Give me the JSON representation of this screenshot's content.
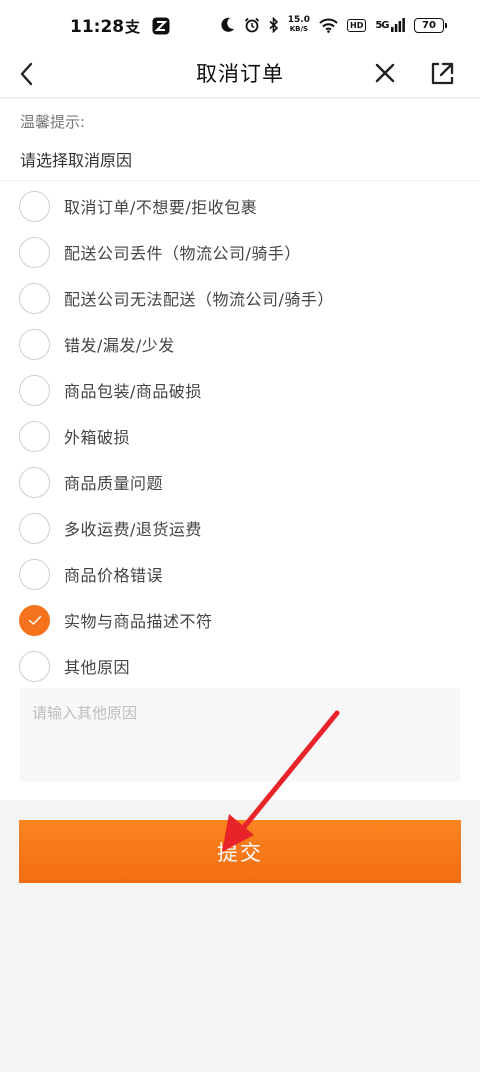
{
  "status_bar": {
    "time": "11:28",
    "speed_value": "15.0",
    "speed_unit": "KB/S",
    "hd": "HD",
    "network": "5G",
    "battery": "70"
  },
  "nav": {
    "title": "取消订单"
  },
  "hint": "温馨提示:",
  "section_title": "请选择取消原因",
  "reasons": [
    {
      "label": "取消订单/不想要/拒收包裹",
      "checked": false
    },
    {
      "label": "配送公司丢件（物流公司/骑手）",
      "checked": false
    },
    {
      "label": "配送公司无法配送（物流公司/骑手）",
      "checked": false
    },
    {
      "label": "错发/漏发/少发",
      "checked": false
    },
    {
      "label": "商品包装/商品破损",
      "checked": false
    },
    {
      "label": "外箱破损",
      "checked": false
    },
    {
      "label": "商品质量问题",
      "checked": false
    },
    {
      "label": "多收运费/退货运费",
      "checked": false
    },
    {
      "label": "商品价格错误",
      "checked": false
    },
    {
      "label": "实物与商品描述不符",
      "checked": true
    },
    {
      "label": "其他原因",
      "checked": false
    }
  ],
  "other_input": {
    "placeholder": "请输入其他原因",
    "value": ""
  },
  "submit_label": "提交",
  "colors": {
    "accent": "#f5731c",
    "arrow": "#e8232a"
  }
}
